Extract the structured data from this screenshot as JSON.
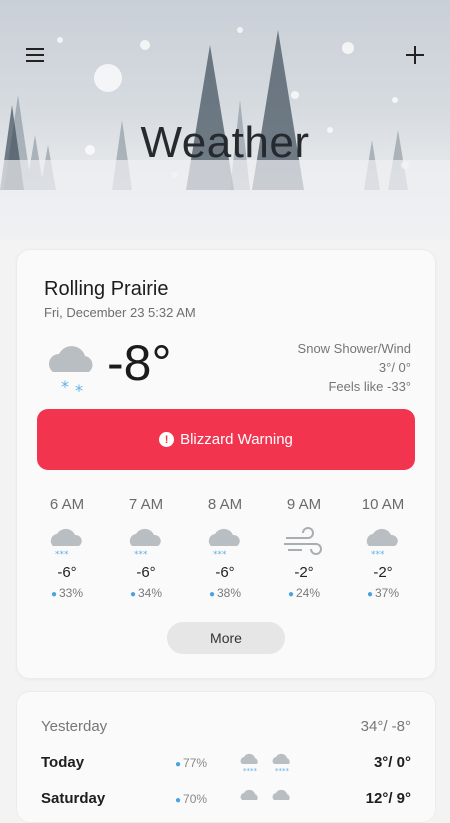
{
  "header": {
    "title": "Weather",
    "menu_icon": "menu-icon",
    "add_icon": "add-icon"
  },
  "current": {
    "location": "Rolling Prairie",
    "datetime": "Fri, December 23 5:32 AM",
    "icon": "snow-cloud-icon",
    "temperature": "-8°",
    "condition": "Snow Shower/Wind",
    "high_low": "3°/ 0°",
    "feels_like": "Feels like -33°"
  },
  "alert": {
    "label": "Blizzard Warning",
    "color": "#f2344f"
  },
  "hourly": [
    {
      "time": "6 AM",
      "icon": "snow-cloud-icon",
      "temp": "-6°",
      "precip": "33%"
    },
    {
      "time": "7 AM",
      "icon": "snow-cloud-icon",
      "temp": "-6°",
      "precip": "34%"
    },
    {
      "time": "8 AM",
      "icon": "snow-cloud-icon",
      "temp": "-6°",
      "precip": "38%"
    },
    {
      "time": "9 AM",
      "icon": "wind-icon",
      "temp": "-2°",
      "precip": "24%"
    },
    {
      "time": "10 AM",
      "icon": "snow-cloud-icon",
      "temp": "-2°",
      "precip": "37%"
    }
  ],
  "more_label": "More",
  "daily": {
    "yesterday_label": "Yesterday",
    "yesterday_range": "34°/ -8°",
    "days": [
      {
        "day": "Today",
        "precip": "77%",
        "range": "3°/ 0°"
      },
      {
        "day": "Saturday",
        "precip": "70%",
        "range": "12°/ 9°"
      }
    ]
  },
  "colors": {
    "accent_alert": "#f2344f",
    "precip_blue": "#4aa3e0",
    "snow_blue": "#5fb0e6"
  }
}
